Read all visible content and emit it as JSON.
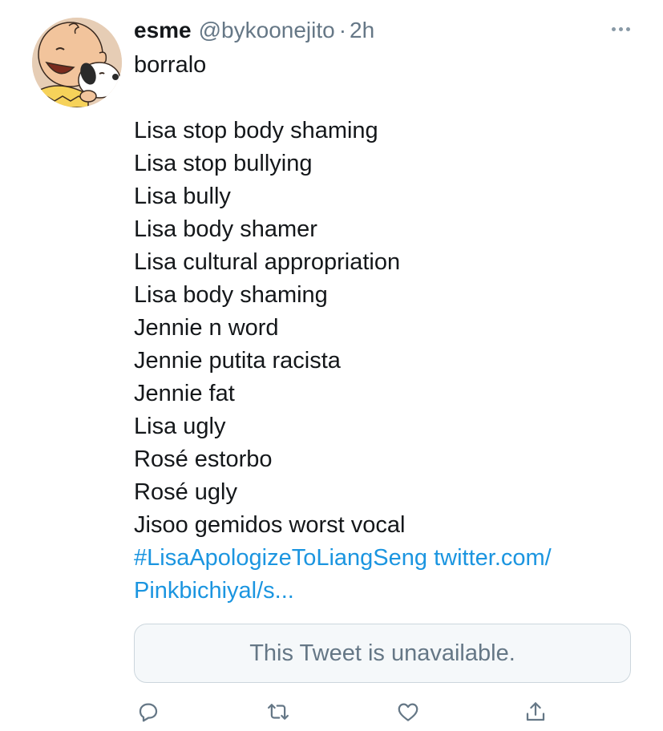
{
  "tweet": {
    "display_name": "esme",
    "handle": "@bykoonejito",
    "separator": "·",
    "time": "2h",
    "lines_top": [
      "borralo"
    ],
    "lines_list": [
      "Lisa stop body shaming",
      "Lisa stop bullying",
      "Lisa bully",
      "Lisa body shamer",
      "Lisa cultural appropriation",
      "Lisa body shaming",
      "Jennie n word",
      "Jennie putita racista",
      "Jennie fat",
      "Lisa ugly",
      "Rosé estorbo",
      "Rosé ugly",
      "Jisoo gemidos worst vocal"
    ],
    "hashtag": "#LisaApologizeToLiangSeng",
    "link_part1": "twitter.com/",
    "link_part2": "Pinkbichiyal/s...",
    "quoted_unavailable": "This Tweet is unavailable."
  },
  "icons": {
    "more": "more-horizontal-icon",
    "reply": "reply-icon",
    "retweet": "retweet-icon",
    "like": "heart-icon",
    "share": "share-icon"
  },
  "colors": {
    "text": "#14171a",
    "secondary": "#657786",
    "link": "#1b95e0",
    "card_border": "#ccd6dd",
    "card_bg": "#f5f8fa"
  }
}
